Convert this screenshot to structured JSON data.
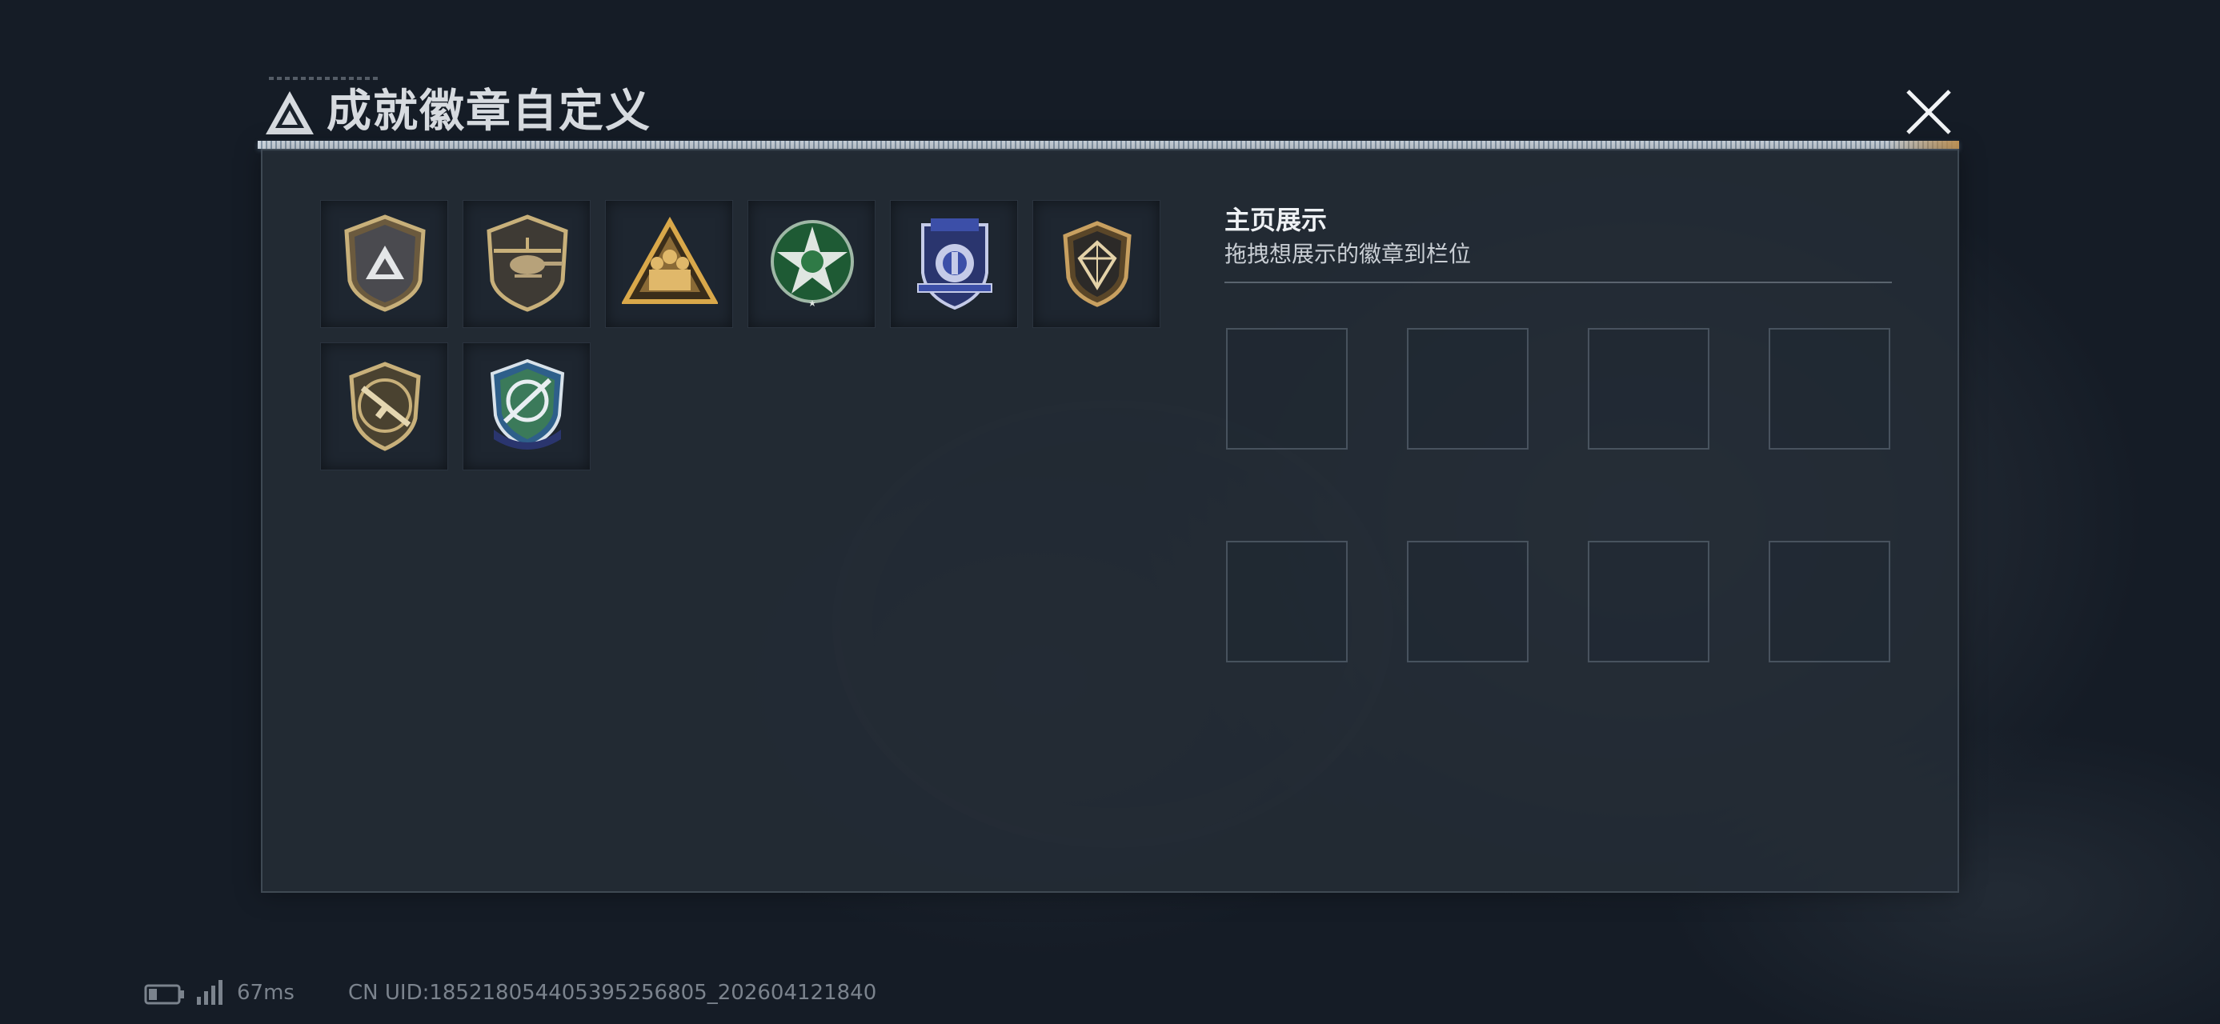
{
  "title_bar": {
    "title": "成就徽章自定义",
    "logo_icon": "triangle-logo-icon",
    "close_icon": "close-icon"
  },
  "owned_badges": [
    {
      "name": "triangle-shield-badge-icon",
      "accent": "#c8b07a"
    },
    {
      "name": "helicopter-shield-badge-icon",
      "accent": "#c8b07a"
    },
    {
      "name": "squad-triangle-badge-icon",
      "accent": "#d9a84a"
    },
    {
      "name": "green-star-badge-icon",
      "accent": "#2f7a46"
    },
    {
      "name": "blue-police-badge-icon",
      "accent": "#3c4fa8"
    },
    {
      "name": "gem-shield-badge-icon",
      "accent": "#c8a060"
    },
    {
      "name": "rifle-emblem-badge-icon",
      "accent": "#c8b07a"
    },
    {
      "name": "crosshair-shield-badge-icon",
      "accent": "#2e5f8a"
    }
  ],
  "display_section": {
    "heading": "主页展示",
    "subtitle": "拖拽想展示的徽章到栏位",
    "slot_count": 8
  },
  "status_bar": {
    "ping": "67ms",
    "uid": "CN UID:18521805440539525​6805_202604121840"
  },
  "colors": {
    "background": "#151c26",
    "panel": "#242c36",
    "title_text": "#d7dbe0",
    "status_text": "#7b838d"
  }
}
